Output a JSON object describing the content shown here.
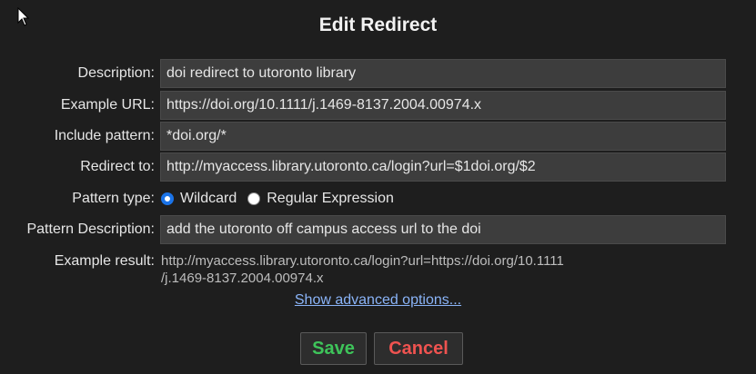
{
  "dialog": {
    "title": "Edit Redirect"
  },
  "form": {
    "description": {
      "label": "Description:",
      "value": "doi redirect to utoronto library"
    },
    "example_url": {
      "label": "Example URL:",
      "value": "https://doi.org/10.1111/j.1469-8137.2004.00974.x"
    },
    "include_pattern": {
      "label": "Include pattern:",
      "value": "*doi.org/*"
    },
    "redirect_to": {
      "label": "Redirect to:",
      "value": "http://myaccess.library.utoronto.ca/login?url=$1doi.org/$2"
    },
    "pattern_type": {
      "label": "Pattern type:",
      "options": [
        "Wildcard",
        "Regular Expression"
      ],
      "selected": "Wildcard"
    },
    "pattern_description": {
      "label": "Pattern Description:",
      "value": "add the utoronto off campus access url to the doi"
    },
    "example_result": {
      "label": "Example result:",
      "line1": "http://myaccess.library.utoronto.ca/login?url=https://doi.org/10.1111",
      "line2": "/j.1469-8137.2004.00974.x"
    }
  },
  "advanced_link": "Show advanced options...",
  "buttons": {
    "save": "Save",
    "cancel": "Cancel"
  },
  "colors": {
    "background": "#1e1e1e",
    "field_bg": "#3d3d3d",
    "save_text": "#3ec45a",
    "cancel_text": "#ef5350",
    "link": "#8ab4f8",
    "radio_accent": "#1a73e8"
  },
  "icons": {
    "cursor": "mouse-pointer-icon"
  }
}
